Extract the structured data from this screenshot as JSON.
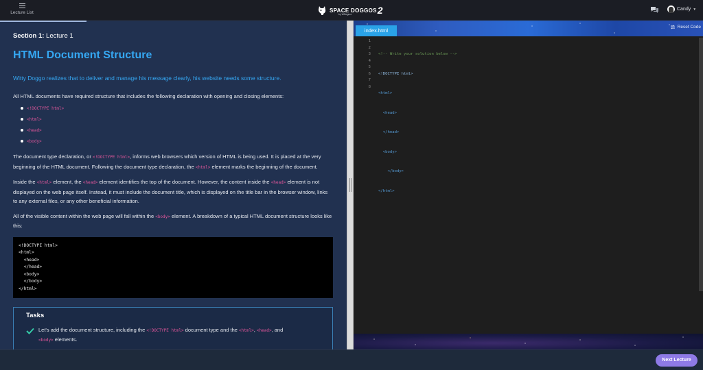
{
  "header": {
    "menu_label": "Lecture List",
    "logo_main": "SPACE DOGGOS",
    "logo_number": "2",
    "logo_byline": "by WDegree",
    "user_name": "Candy"
  },
  "lesson": {
    "section_label": "Section 1:",
    "lecture_label": "Lecture 1",
    "title": "HTML Document Structure",
    "intro": "Witty Doggo realizes that to deliver and manage his message clearly, his website needs some structure.",
    "p1": "All HTML documents have required structure that includes the following declaration with opening and closing elements:",
    "required_items": [
      "<!DOCTYPE html>",
      "<html>",
      "<head>",
      "<body>"
    ],
    "p2": {
      "a": "The document type declaration, or ",
      "code1": "<!DOCTYPE html>",
      "b": ", informs web browsers which version of HTML is being used. It is placed at the very beginning of the HTML document. Following the document type declaration, the ",
      "code2": "<html>",
      "c": " element marks the beginning of the document."
    },
    "p3": {
      "a": "Inside the ",
      "code1": "<html>",
      "b": " element, the ",
      "code2": "<head>",
      "c": " element identifies the top of the document. However, the content inside the ",
      "code3": "<head>",
      "d": " element is not displayed on the web page itself. Instead, it must include the document title, which is displayed on the title bar in the browser window, links to any external files, or any other beneficial information."
    },
    "p4": {
      "a": "All of the visible content within the web page will fall within the ",
      "code1": "<body>",
      "b": " element. A breakdown of a typical HTML document structure looks like this:"
    },
    "example_code": "<!DOCTYPE html>\n<html>\n  <head>\n  </head>\n  <body>\n  </body>\n</html>",
    "tasks_heading": "Tasks",
    "task1": {
      "a": "Let's add the document structure, including the ",
      "code1": "<!DOCTYPE html>",
      "b": " document type and the ",
      "code2": "<html>",
      "c": ", ",
      "code3": "<head>",
      "d": ", and ",
      "code4": "<body>",
      "e": " elements."
    }
  },
  "editor": {
    "tab_label": "index.html",
    "reset_label": "Reset Code",
    "line_numbers": [
      "1",
      "2",
      "3",
      "4",
      "5",
      "6",
      "7",
      "8"
    ],
    "lines": [
      "<!-- Write your solution below -->",
      "<!DOCTYPE html>",
      "<html>",
      "  <head>",
      "  </head>",
      "  <body>",
      "    </body>",
      "</html>"
    ]
  },
  "footer": {
    "next_label": "Next Lecture"
  },
  "colors": {
    "accent_blue": "#35a7f2",
    "inline_code": "#e0569a",
    "next_button": "#8e7ae6",
    "lesson_bg": "#213150"
  }
}
